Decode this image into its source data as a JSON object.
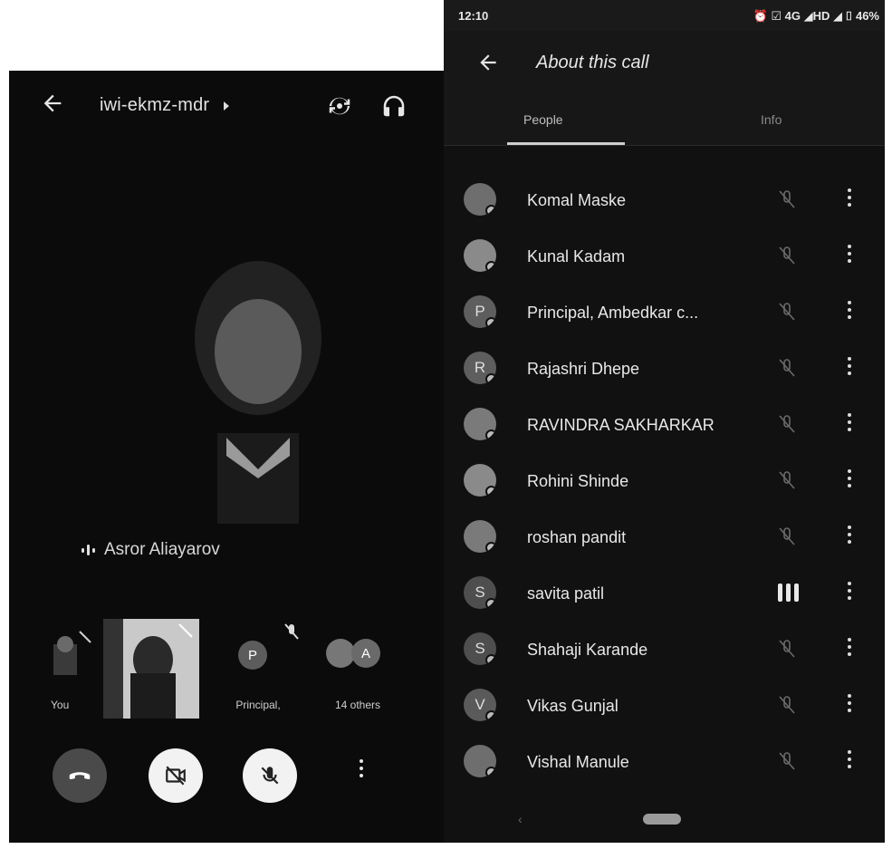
{
  "call": {
    "meeting_code": "iwi-ekmz-mdr",
    "active_speaker": "Asror Aliayarov",
    "tiles": [
      {
        "label": "You"
      },
      {
        "label": ""
      },
      {
        "label": "Principal,",
        "avatar_initial": "P"
      },
      {
        "label": "14 others",
        "avatar_initial": "A"
      }
    ],
    "icons": {
      "back": "arrow-left-icon",
      "switch_camera": "switch-camera-icon",
      "audio_output": "headphones-icon",
      "end_call": "phone-hangup-icon",
      "camera_off": "video-off-icon",
      "mic_off": "mic-off-icon",
      "more": "more-vert-icon"
    }
  },
  "status_bar": {
    "time": "12:10",
    "indicators": "⏰ ☑ 4G ◢HD ◢ ⌷ 46%"
  },
  "about": {
    "title": "About this call",
    "tabs": [
      "People",
      "Info"
    ],
    "participants": [
      {
        "name": "Komal Maske",
        "initial": "",
        "muted": true
      },
      {
        "name": "Kunal Kadam",
        "initial": "",
        "muted": true
      },
      {
        "name": "Principal, Ambedkar c...",
        "initial": "P",
        "muted": true
      },
      {
        "name": "Rajashri Dhepe",
        "initial": "R",
        "muted": true
      },
      {
        "name": "RAVINDRA SAKHARKAR",
        "initial": "",
        "muted": true
      },
      {
        "name": "Rohini Shinde",
        "initial": "",
        "muted": true
      },
      {
        "name": "roshan pandit",
        "initial": "",
        "muted": true
      },
      {
        "name": "savita patil",
        "initial": "S",
        "muted": false
      },
      {
        "name": "Shahaji Karande",
        "initial": "S",
        "muted": true
      },
      {
        "name": "Vikas Gunjal",
        "initial": "V",
        "muted": true
      },
      {
        "name": "Vishal Manule",
        "initial": "",
        "muted": true
      }
    ]
  },
  "colors": {
    "call_bg": "#0b0b0b",
    "panel_bg": "#111111",
    "end_call": "#4a4a4a",
    "control_light": "#f2f2f2"
  }
}
